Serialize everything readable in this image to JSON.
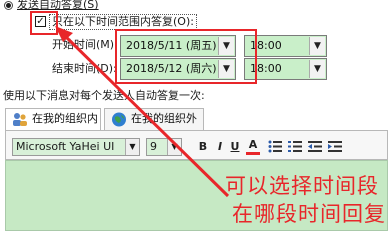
{
  "auto_reply": {
    "send_label": "发送自动答复(S)",
    "time_range_label": "只在以下时间范围内答复(O):",
    "time_range_checked": true,
    "start_label": "开始时间(M):",
    "start_date": "2018/5/11 (周五)",
    "start_time": "18:00",
    "end_label": "结束时间(D):",
    "end_date": "2018/5/12 (周六)",
    "end_time": "18:00"
  },
  "reply_section": {
    "label": "使用以下消息对每个发送人自动答复一次:"
  },
  "tabs": [
    {
      "label": "在我的组织内",
      "active": true
    },
    {
      "label": "在我的组织外(T)",
      "active": false
    }
  ],
  "toolbar": {
    "font": "Microsoft YaHei UI",
    "size": "9",
    "bold": "B",
    "italic": "I",
    "underline": "U",
    "font_color": "A"
  },
  "annotation": {
    "line1": "可以选择时间段",
    "line2": "在哪段时间回复"
  },
  "colors": {
    "highlight": "#e8262a",
    "field_fill": "#c9efc9",
    "editor_fill": "#c6e9c4"
  }
}
